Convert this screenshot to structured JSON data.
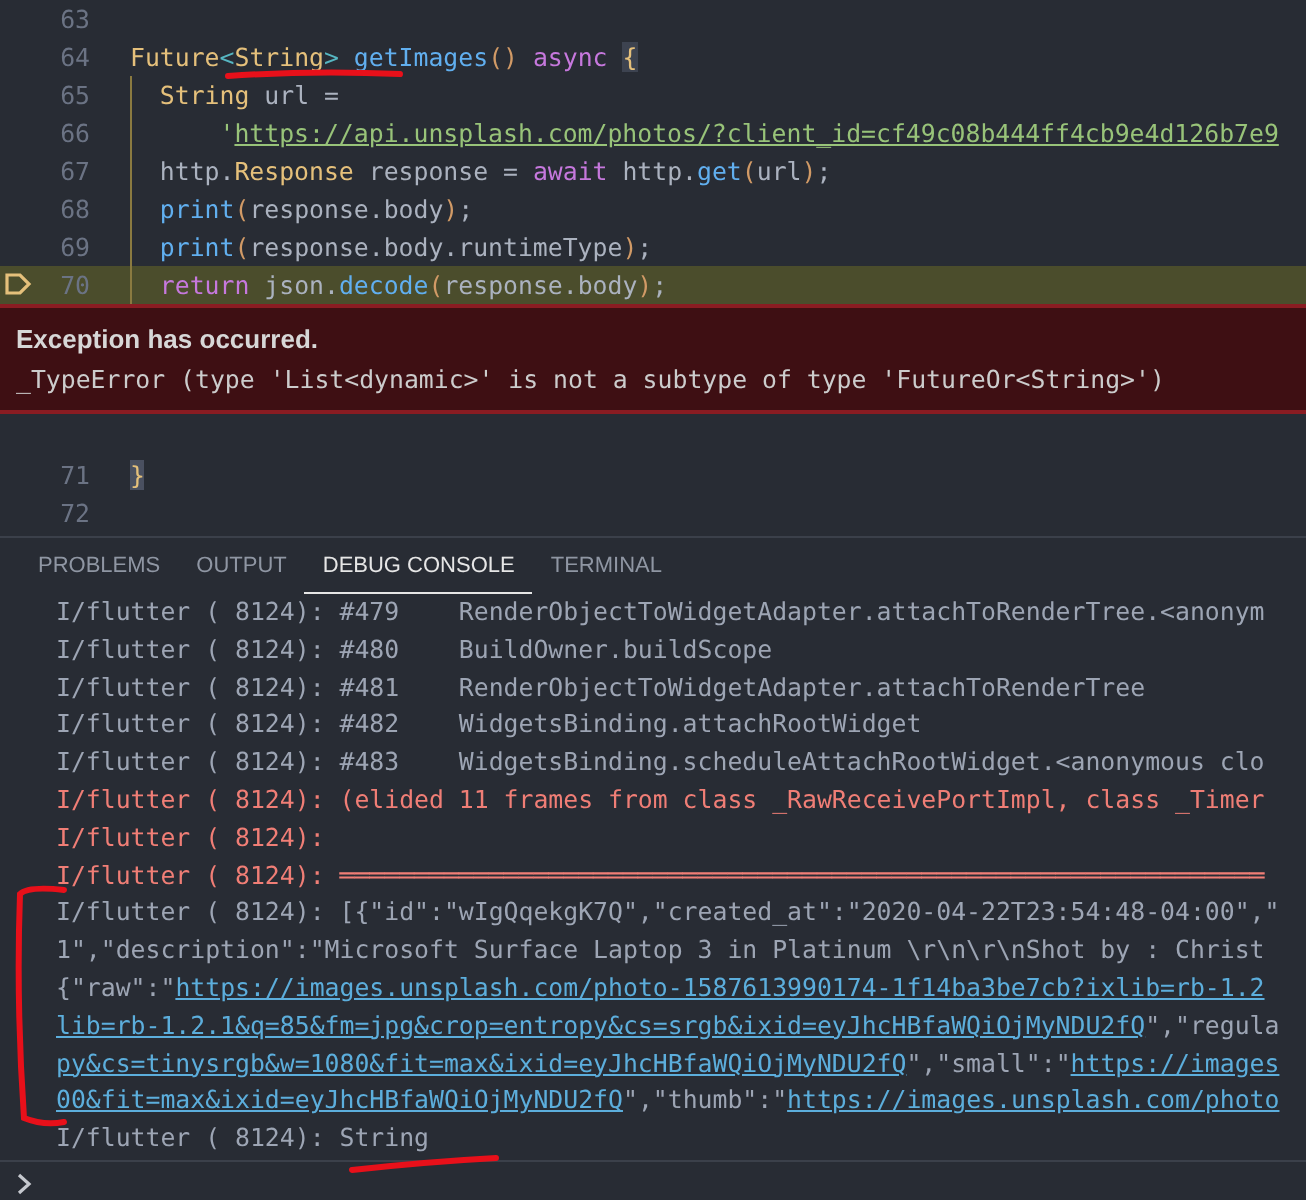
{
  "editor": {
    "lines": [
      {
        "number": "63",
        "current": false,
        "scope": false
      },
      {
        "number": "64",
        "current": false,
        "scope": false,
        "tokens": [
          {
            "kind": "type",
            "text": "Future"
          },
          {
            "kind": "punct",
            "text": "<"
          },
          {
            "kind": "type",
            "text": "String"
          },
          {
            "kind": "punct",
            "text": "> "
          },
          {
            "kind": "fn",
            "text": "getImages"
          },
          {
            "kind": "paren",
            "text": "() "
          },
          {
            "kind": "keyword",
            "text": "async "
          },
          {
            "kind": "brace",
            "text": "{"
          }
        ]
      },
      {
        "number": "65",
        "current": false,
        "scope": true,
        "tokens": [
          {
            "kind": "type",
            "text": "  String"
          },
          {
            "kind": "plain",
            "text": " url ="
          }
        ]
      },
      {
        "number": "66",
        "current": false,
        "scope": true,
        "tokens": [
          {
            "kind": "string",
            "text": "      '"
          },
          {
            "kind": "link",
            "text": "https://api.unsplash.com/photos/?client_id=cf49c08b444ff4cb9e4d126b7e9"
          }
        ]
      },
      {
        "number": "67",
        "current": false,
        "scope": true,
        "tokens": [
          {
            "kind": "plain",
            "text": "  http."
          },
          {
            "kind": "type",
            "text": "Response"
          },
          {
            "kind": "plain",
            "text": " response = "
          },
          {
            "kind": "keyword",
            "text": "await"
          },
          {
            "kind": "plain",
            "text": " http."
          },
          {
            "kind": "fn",
            "text": "get"
          },
          {
            "kind": "paren",
            "text": "("
          },
          {
            "kind": "plain",
            "text": "url"
          },
          {
            "kind": "paren",
            "text": ")"
          },
          {
            "kind": "plain",
            "text": ";"
          }
        ]
      },
      {
        "number": "68",
        "current": false,
        "scope": true,
        "tokens": [
          {
            "kind": "fn",
            "text": "  print"
          },
          {
            "kind": "paren",
            "text": "("
          },
          {
            "kind": "plain",
            "text": "response.body"
          },
          {
            "kind": "paren",
            "text": ")"
          },
          {
            "kind": "plain",
            "text": ";"
          }
        ]
      },
      {
        "number": "69",
        "current": false,
        "scope": true,
        "tokens": [
          {
            "kind": "fn",
            "text": "  print"
          },
          {
            "kind": "paren",
            "text": "("
          },
          {
            "kind": "plain",
            "text": "response.body.runtimeType"
          },
          {
            "kind": "paren",
            "text": ")"
          },
          {
            "kind": "plain",
            "text": ";"
          }
        ]
      },
      {
        "number": "70",
        "current": true,
        "scope": true,
        "tokens": [
          {
            "kind": "keyword",
            "text": "  return"
          },
          {
            "kind": "plain",
            "text": " json."
          },
          {
            "kind": "fn",
            "text": "decode"
          },
          {
            "kind": "paren",
            "text": "("
          },
          {
            "kind": "plain",
            "text": "response.body"
          },
          {
            "kind": "paren",
            "text": ")"
          },
          {
            "kind": "plain",
            "text": ";"
          }
        ]
      }
    ],
    "exception": {
      "title": "Exception has occurred.",
      "message": "_TypeError (type 'List<dynamic>' is not a subtype of type 'FutureOr<String>')"
    },
    "lines_after": [
      {
        "number": "71",
        "current": false,
        "scope": false,
        "tokens": [
          {
            "kind": "brace",
            "text": "}"
          }
        ]
      },
      {
        "number": "72",
        "current": false,
        "scope": false
      }
    ]
  },
  "panel": {
    "tabs": [
      {
        "label": "PROBLEMS",
        "selected": false
      },
      {
        "label": "OUTPUT",
        "selected": false
      },
      {
        "label": "DEBUG CONSOLE",
        "selected": true
      },
      {
        "label": "TERMINAL",
        "selected": false
      }
    ],
    "console": [
      {
        "kind": "log",
        "segments": [
          {
            "kind": "plain",
            "text": "I/flutter ( 8124): #479    RenderObjectToWidgetAdapter.attachToRenderTree.<anonym"
          }
        ]
      },
      {
        "kind": "log",
        "segments": [
          {
            "kind": "plain",
            "text": "I/flutter ( 8124): #480    BuildOwner.buildScope"
          }
        ]
      },
      {
        "kind": "log",
        "segments": [
          {
            "kind": "plain",
            "text": "I/flutter ( 8124): #481    RenderObjectToWidgetAdapter.attachToRenderTree"
          }
        ]
      },
      {
        "kind": "log",
        "segments": [
          {
            "kind": "plain",
            "text": "I/flutter ( 8124): #482    WidgetsBinding.attachRootWidget"
          }
        ]
      },
      {
        "kind": "log",
        "segments": [
          {
            "kind": "plain",
            "text": "I/flutter ( 8124): #483    WidgetsBinding.scheduleAttachRootWidget.<anonymous clo"
          }
        ]
      },
      {
        "kind": "error",
        "segments": [
          {
            "kind": "plain",
            "text": "I/flutter ( 8124): (elided 11 frames from class _RawReceivePortImpl, class _Timer"
          }
        ]
      },
      {
        "kind": "error",
        "segments": [
          {
            "kind": "plain",
            "text": "I/flutter ( 8124):"
          }
        ]
      },
      {
        "kind": "error",
        "segments": [
          {
            "kind": "plain",
            "text": "I/flutter ( 8124): ══════════════════════════════════════════════════════════════"
          }
        ]
      },
      {
        "kind": "log",
        "segments": [
          {
            "kind": "plain",
            "text": "I/flutter ( 8124): [{\"id\":\"wIgQqekgK7Q\",\"created_at\":\"2020-04-22T23:54:48-04:00\",\""
          }
        ]
      },
      {
        "kind": "log",
        "segments": [
          {
            "kind": "plain",
            "text": "1\",\"description\":\"Microsoft Surface Laptop 3 in Platinum \\r\\n\\r\\nShot by : Christ"
          }
        ]
      },
      {
        "kind": "log",
        "segments": [
          {
            "kind": "plain",
            "text": "{\"raw\":\""
          },
          {
            "kind": "link",
            "text": "https://images.unsplash.com/photo-1587613990174-1f14ba3be7cb?ixlib=rb-1.2"
          }
        ]
      },
      {
        "kind": "log",
        "segments": [
          {
            "kind": "link",
            "text": "lib=rb-1.2.1&q=85&fm=jpg&crop=entropy&cs=srgb&ixid=eyJhcHBfaWQiOjMyNDU2fQ"
          },
          {
            "kind": "plain",
            "text": "\",\"regula"
          }
        ]
      },
      {
        "kind": "log",
        "segments": [
          {
            "kind": "link",
            "text": "py&cs=tinysrgb&w=1080&fit=max&ixid=eyJhcHBfaWQiOjMyNDU2fQ"
          },
          {
            "kind": "plain",
            "text": "\",\"small\":\""
          },
          {
            "kind": "link",
            "text": "https://images"
          }
        ]
      },
      {
        "kind": "log",
        "segments": [
          {
            "kind": "link",
            "text": "00&fit=max&ixid=eyJhcHBfaWQiOjMyNDU2fQ"
          },
          {
            "kind": "plain",
            "text": "\",\"thumb\":\""
          },
          {
            "kind": "link",
            "text": "https://images.unsplash.com/photo"
          }
        ]
      },
      {
        "kind": "log",
        "segments": [
          {
            "kind": "plain",
            "text": "I/flutter ( 8124): String"
          }
        ]
      }
    ]
  }
}
